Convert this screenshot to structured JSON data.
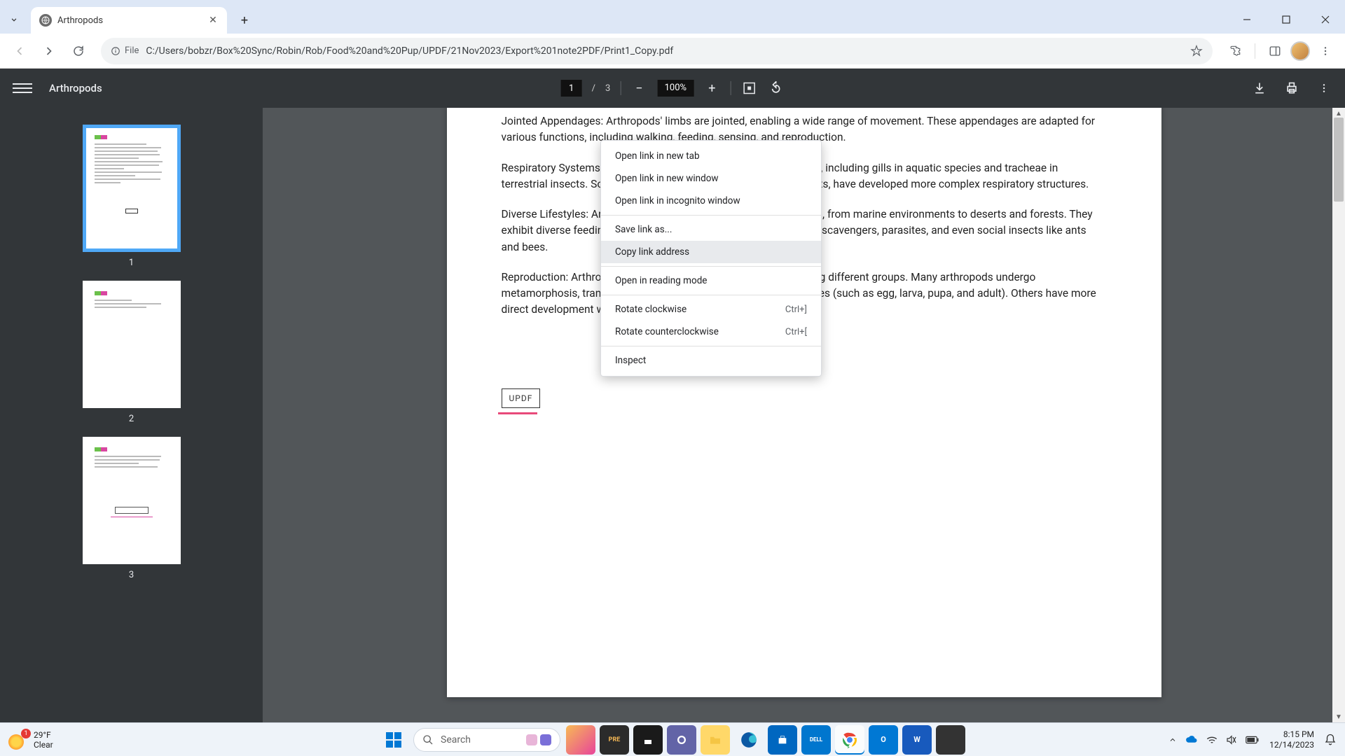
{
  "browser": {
    "tab_title": "Arthropods",
    "url": "C:/Users/bobzr/Box%20Sync/Robin/Rob/Food%20and%20Pup/UPDF/21Nov2023/Export%201note2PDF/Print1_Copy.pdf",
    "file_label": "File"
  },
  "pdf": {
    "title": "Arthropods",
    "current_page": "1",
    "total_pages": "3",
    "page_sep": "/",
    "zoom": "100%",
    "thumbs": [
      "1",
      "2",
      "3"
    ],
    "content": {
      "p1": "Jointed Appendages: Arthropods' limbs are jointed, enabling a wide range of movement. These appendages are adapted for various functions, including walking, feeding, sensing, and reproduction.",
      "p2": "Respiratory Systems: Arthropods have diverse respiratory systems, including gills in aquatic species and tracheae in terrestrial insects. Some arthropods, like spiders and certain insects, have developed more complex respiratory structures.",
      "p3": "Diverse Lifestyles: Arthropods occupy nearly every habitat on Earth, from marine environments to deserts and forests. They exhibit diverse feeding strategies, including herbivores, carnivores, scavengers, parasites, and even social insects like ants and bees.",
      "p4": "Reproduction: Arthropod reproductive strategies vary widely among different groups. Many arthropods undergo metamorphosis, transitioning through distinct developmental stages (such as egg, larva, pupa, and adult). Others have more direct development with fewer changes.",
      "stamp": "UPDF"
    }
  },
  "context_menu": {
    "open_new_tab": "Open link in new tab",
    "open_new_window": "Open link in new window",
    "open_incognito": "Open link in incognito window",
    "save_link": "Save link as...",
    "copy_link": "Copy link address",
    "reading_mode": "Open in reading mode",
    "rotate_cw": "Rotate clockwise",
    "rotate_cw_key": "Ctrl+]",
    "rotate_ccw": "Rotate counterclockwise",
    "rotate_ccw_key": "Ctrl+[",
    "inspect": "Inspect"
  },
  "taskbar": {
    "weather_badge": "1",
    "weather_temp": "29°F",
    "weather_desc": "Clear",
    "search_placeholder": "Search",
    "time": "8:15 PM",
    "date": "12/14/2023"
  }
}
